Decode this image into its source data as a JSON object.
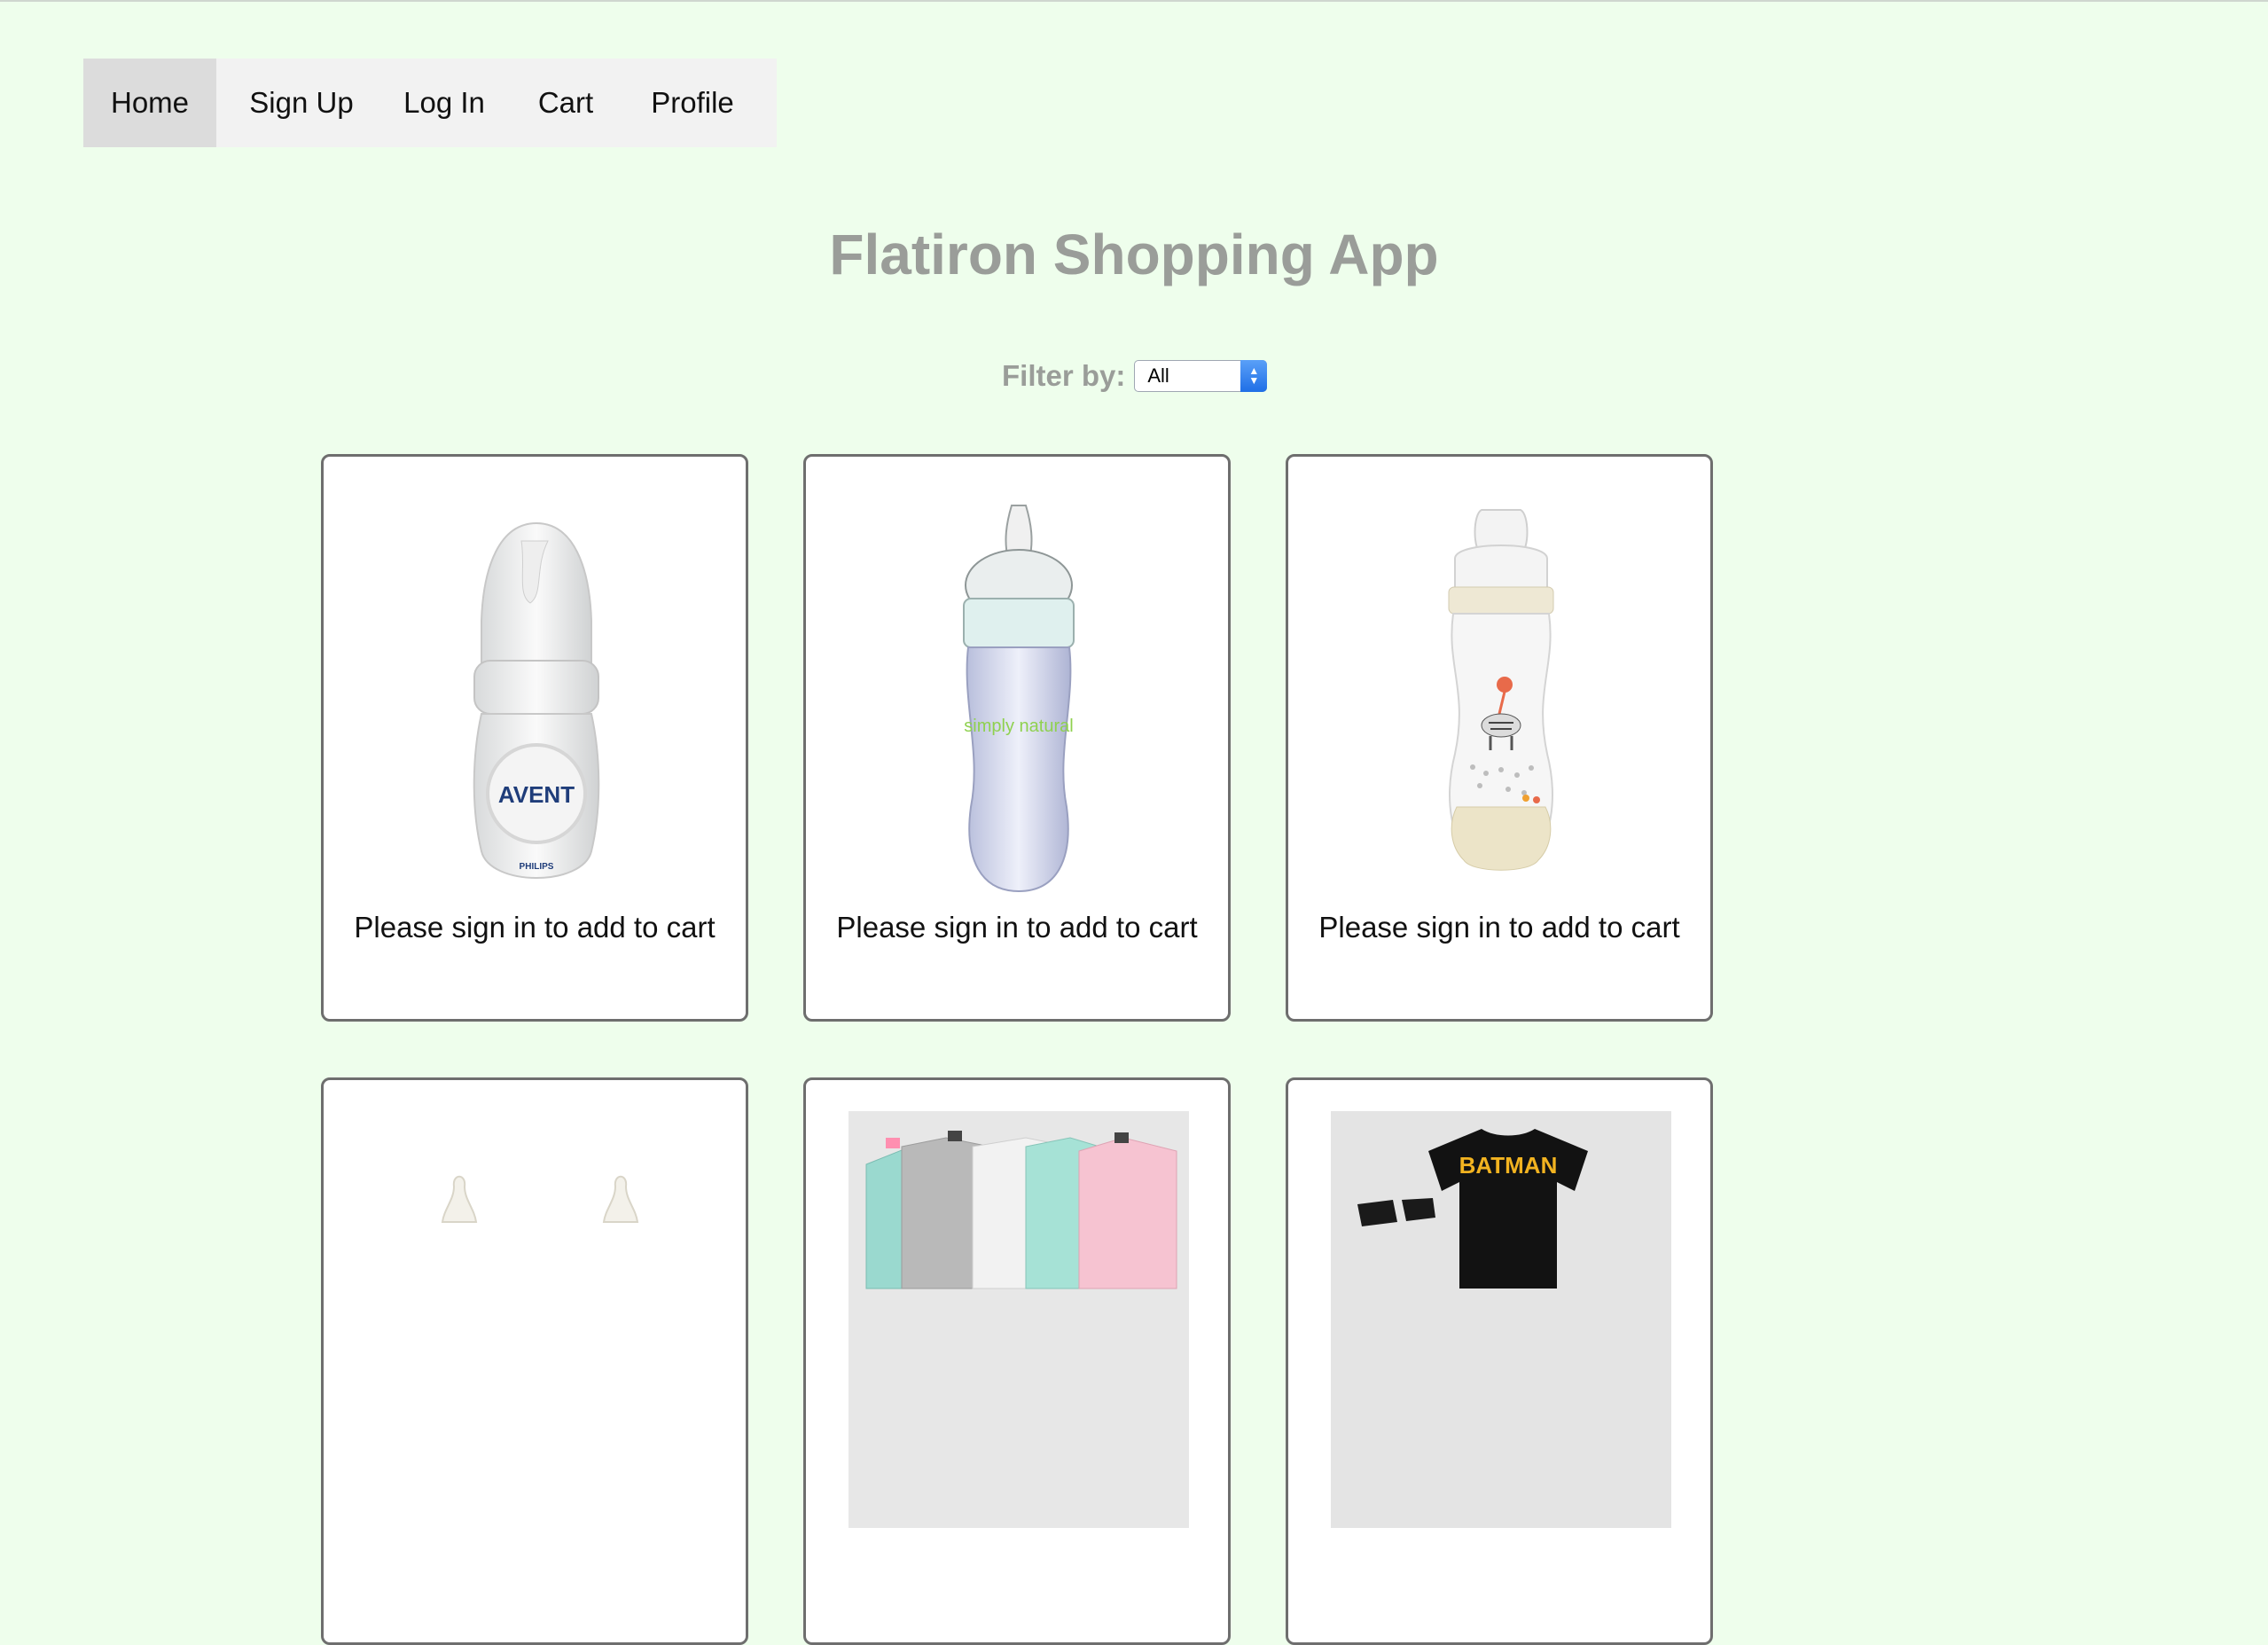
{
  "nav": {
    "items": [
      {
        "label": "Home",
        "active": true
      },
      {
        "label": "Sign Up"
      },
      {
        "label": "Log In"
      },
      {
        "label": "Cart"
      },
      {
        "label": "Profile"
      }
    ]
  },
  "page": {
    "title": "Flatiron Shopping App"
  },
  "filter": {
    "label": "Filter by:",
    "selected": "All"
  },
  "products": [
    {
      "image_icon": "baby-bottle-icon",
      "brand_text": "AVENT",
      "sub_text": "PHILIPS",
      "message": "Please sign in to add to cart"
    },
    {
      "image_icon": "baby-bottle-icon",
      "brand_text": "simply natural",
      "message": "Please sign in to add to cart"
    },
    {
      "image_icon": "baby-bottle-icon",
      "message": "Please sign in to add to cart"
    },
    {
      "image_icon": "bottle-nipples-icon"
    },
    {
      "image_icon": "baby-sleepers-icon"
    },
    {
      "image_icon": "baby-onesie-icon",
      "brand_text": "BATMAN"
    }
  ],
  "colors": {
    "background": "#eefeec",
    "title": "#9a9d99",
    "nav_bg": "#f2f2f2",
    "nav_active": "#dcdcdc",
    "card_border": "#6e6e6e"
  }
}
